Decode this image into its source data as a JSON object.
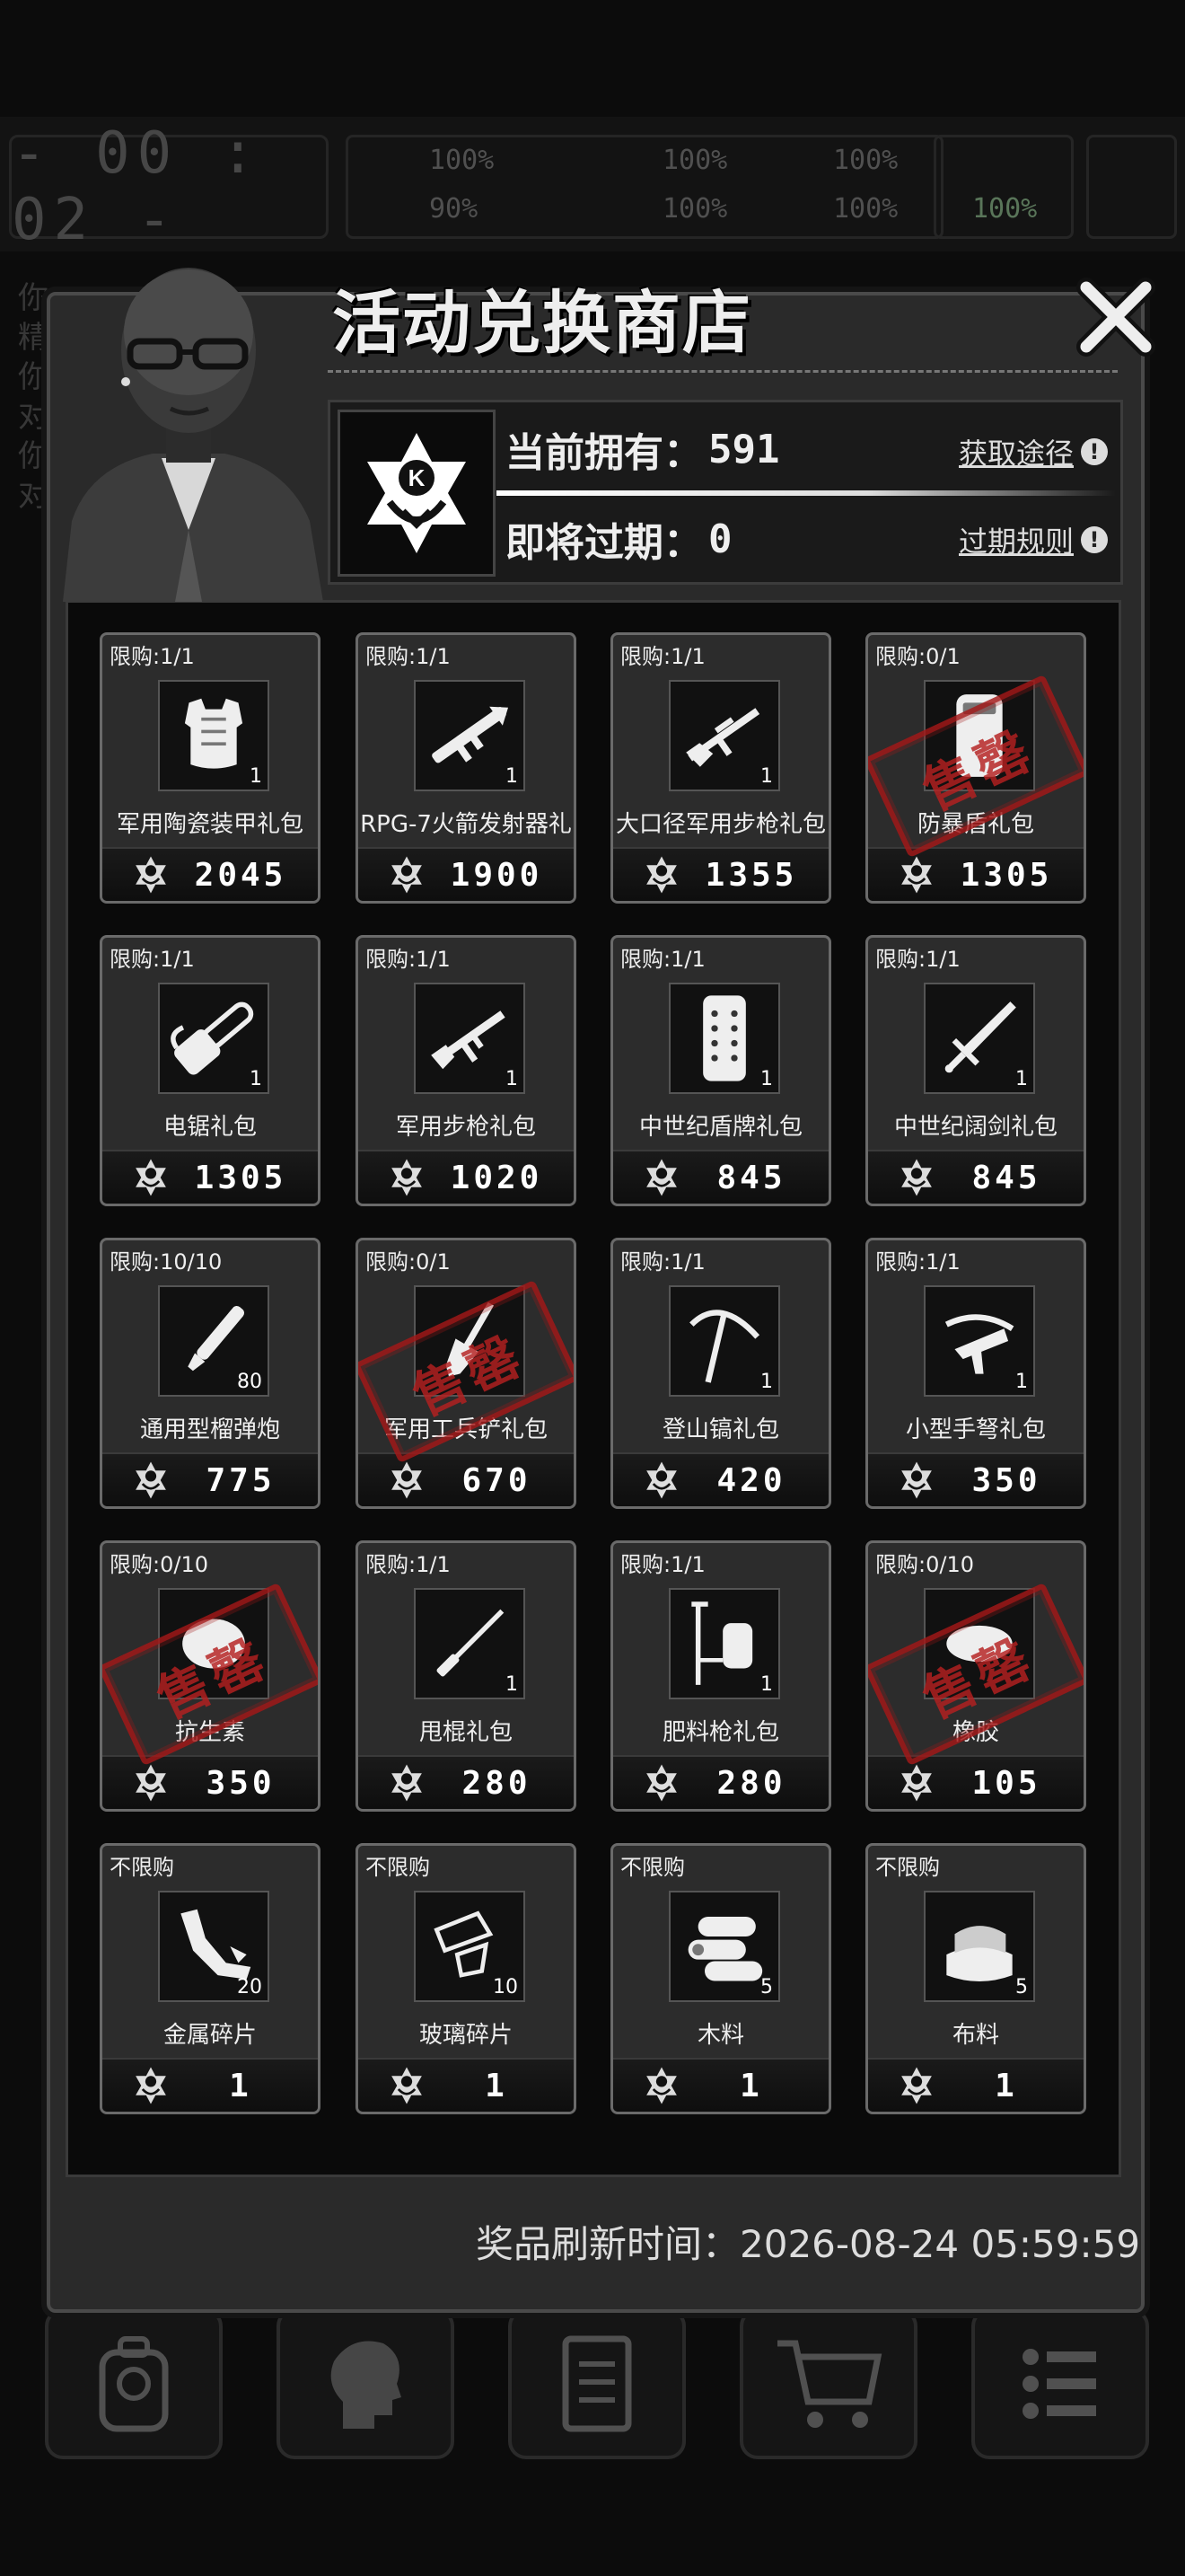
{
  "background": {
    "timer": "- 00 : 02 -",
    "stats": [
      "100%",
      "90%",
      "100%",
      "100%",
      "100%",
      "100%",
      "100%"
    ],
    "side_text": [
      "你",
      "精",
      "你",
      "对",
      "你",
      "对"
    ]
  },
  "shop": {
    "title": "活动兑换商店",
    "owned_label": "当前拥有：",
    "owned_value": "591",
    "expire_label": "即将过期：",
    "expire_value": "0",
    "obtain_link": "获取途径",
    "expire_rules_link": "过期规则",
    "refresh_label": "奖品刷新时间：",
    "refresh_time": "2026-08-24 05:59:59",
    "sold_out_text": "售罄"
  },
  "items": [
    {
      "limit": "限购:1/1",
      "name": "军用陶瓷装甲礼包",
      "qty": "1",
      "price": "2045",
      "icon": "armor-vest-icon",
      "sold": false
    },
    {
      "limit": "限购:1/1",
      "name": "RPG-7火箭发射器礼",
      "qty": "1",
      "price": "1900",
      "icon": "rocket-launcher-icon",
      "sold": false
    },
    {
      "limit": "限购:1/1",
      "name": "大口径军用步枪礼包",
      "qty": "1",
      "price": "1355",
      "icon": "large-rifle-icon",
      "sold": false
    },
    {
      "limit": "限购:0/1",
      "name": "防暴盾礼包",
      "qty": "",
      "price": "1305",
      "icon": "riot-shield-icon",
      "sold": true
    },
    {
      "limit": "限购:1/1",
      "name": "电锯礼包",
      "qty": "1",
      "price": "1305",
      "icon": "chainsaw-icon",
      "sold": false
    },
    {
      "limit": "限购:1/1",
      "name": "军用步枪礼包",
      "qty": "1",
      "price": "1020",
      "icon": "assault-rifle-icon",
      "sold": false
    },
    {
      "limit": "限购:1/1",
      "name": "中世纪盾牌礼包",
      "qty": "1",
      "price": "845",
      "icon": "medieval-shield-icon",
      "sold": false
    },
    {
      "limit": "限购:1/1",
      "name": "中世纪阔剑礼包",
      "qty": "1",
      "price": "845",
      "icon": "broadsword-icon",
      "sold": false
    },
    {
      "limit": "限购:10/10",
      "name": "通用型榴弹炮",
      "qty": "80",
      "price": "775",
      "icon": "grenade-shell-icon",
      "sold": false
    },
    {
      "limit": "限购:0/1",
      "name": "军用工兵铲礼包",
      "qty": "",
      "price": "670",
      "icon": "shovel-icon",
      "sold": true
    },
    {
      "limit": "限购:1/1",
      "name": "登山镐礼包",
      "qty": "1",
      "price": "420",
      "icon": "ice-axe-icon",
      "sold": false
    },
    {
      "limit": "限购:1/1",
      "name": "小型手弩礼包",
      "qty": "1",
      "price": "350",
      "icon": "crossbow-icon",
      "sold": false
    },
    {
      "limit": "限购:0/10",
      "name": "抗生素",
      "qty": "",
      "price": "350",
      "icon": "antibiotics-icon",
      "sold": true
    },
    {
      "limit": "限购:1/1",
      "name": "甩棍礼包",
      "qty": "1",
      "price": "280",
      "icon": "baton-icon",
      "sold": false
    },
    {
      "limit": "限购:1/1",
      "name": "肥料枪礼包",
      "qty": "1",
      "price": "280",
      "icon": "fertilizer-gun-icon",
      "sold": false
    },
    {
      "limit": "限购:0/10",
      "name": "橡胶",
      "qty": "",
      "price": "105",
      "icon": "rubber-icon",
      "sold": true
    },
    {
      "limit": "不限购",
      "name": "金属碎片",
      "qty": "20",
      "price": "1",
      "icon": "metal-scrap-icon",
      "sold": false
    },
    {
      "limit": "不限购",
      "name": "玻璃碎片",
      "qty": "10",
      "price": "1",
      "icon": "glass-shard-icon",
      "sold": false
    },
    {
      "limit": "不限购",
      "name": "木料",
      "qty": "5",
      "price": "1",
      "icon": "wood-logs-icon",
      "sold": false
    },
    {
      "limit": "不限购",
      "name": "布料",
      "qty": "5",
      "price": "1",
      "icon": "cloth-icon",
      "sold": false
    }
  ]
}
